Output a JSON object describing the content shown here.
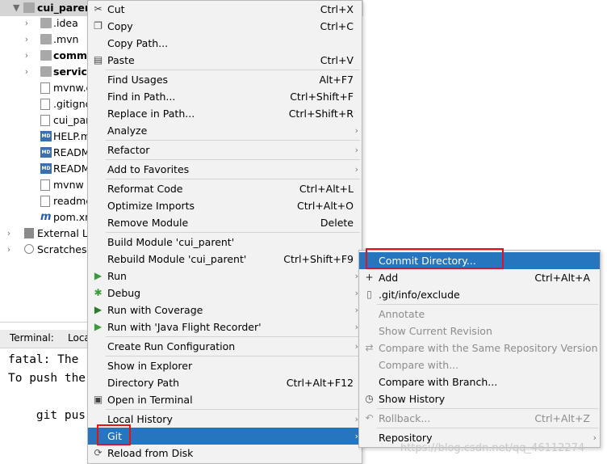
{
  "tree": {
    "root": "cui_parent",
    "items": [
      {
        "label": ".idea",
        "bold": false,
        "icon": "folder"
      },
      {
        "label": ".mvn",
        "bold": false,
        "icon": "folder"
      },
      {
        "label": "commo",
        "bold": true,
        "icon": "folder"
      },
      {
        "label": "service",
        "bold": true,
        "icon": "folder"
      },
      {
        "label": "mvnw.c",
        "bold": false,
        "icon": "file"
      },
      {
        "label": ".gitignc",
        "bold": false,
        "icon": "file"
      },
      {
        "label": "cui_par",
        "bold": false,
        "icon": "file"
      },
      {
        "label": "HELP.m",
        "bold": false,
        "icon": "md"
      },
      {
        "label": "READM",
        "bold": false,
        "icon": "md"
      },
      {
        "label": "READM",
        "bold": false,
        "icon": "md"
      },
      {
        "label": "mvnw",
        "bold": false,
        "icon": "file"
      },
      {
        "label": "readme",
        "bold": false,
        "icon": "file"
      },
      {
        "label": "pom.xn",
        "bold": false,
        "icon": "m"
      }
    ],
    "external": "External Lib",
    "scratches": "Scratches a"
  },
  "terminal": {
    "tab_label": "Terminal:",
    "tab_local": "Loca",
    "lines": [
      "fatal: The",
      "To push the",
      "",
      "    git pus"
    ]
  },
  "menu": {
    "items": [
      {
        "label": "Cut",
        "shortcut": "Ctrl+X",
        "icon": "cut-icon"
      },
      {
        "label": "Copy",
        "shortcut": "Ctrl+C",
        "icon": "copy-icon"
      },
      {
        "label": "Copy Path...",
        "shortcut": ""
      },
      {
        "label": "Paste",
        "shortcut": "Ctrl+V",
        "icon": "paste-icon"
      },
      {
        "label": "Find Usages",
        "shortcut": "Alt+F7"
      },
      {
        "label": "Find in Path...",
        "shortcut": "Ctrl+Shift+F"
      },
      {
        "label": "Replace in Path...",
        "shortcut": "Ctrl+Shift+R"
      },
      {
        "label": "Analyze",
        "shortcut": "",
        "submenu": true
      },
      {
        "label": "Refactor",
        "shortcut": "",
        "submenu": true
      },
      {
        "label": "Add to Favorites",
        "shortcut": "",
        "submenu": true
      },
      {
        "label": "Reformat Code",
        "shortcut": "Ctrl+Alt+L"
      },
      {
        "label": "Optimize Imports",
        "shortcut": "Ctrl+Alt+O"
      },
      {
        "label": "Remove Module",
        "shortcut": "Delete"
      },
      {
        "label": "Build Module 'cui_parent'",
        "shortcut": ""
      },
      {
        "label": "Rebuild Module 'cui_parent'",
        "shortcut": "Ctrl+Shift+F9"
      },
      {
        "label": "Run",
        "shortcut": "",
        "submenu": true,
        "icon": "run-icon"
      },
      {
        "label": "Debug",
        "shortcut": "",
        "submenu": true,
        "icon": "debug-icon"
      },
      {
        "label": "Run with Coverage",
        "shortcut": "",
        "submenu": true,
        "icon": "coverage-icon"
      },
      {
        "label": "Run with 'Java Flight Recorder'",
        "shortcut": "",
        "submenu": true,
        "icon": "flight-recorder-icon"
      },
      {
        "label": "Create Run Configuration",
        "shortcut": "",
        "submenu": true
      },
      {
        "label": "Show in Explorer",
        "shortcut": ""
      },
      {
        "label": "Directory Path",
        "shortcut": "Ctrl+Alt+F12"
      },
      {
        "label": "Open in Terminal",
        "shortcut": "",
        "icon": "terminal-icon"
      },
      {
        "label": "Local History",
        "shortcut": "",
        "submenu": true
      },
      {
        "label": "Git",
        "shortcut": "",
        "submenu": true,
        "highlighted": true
      },
      {
        "label": "Reload from Disk",
        "shortcut": "",
        "icon": "reload-icon"
      }
    ]
  },
  "git_menu": {
    "items": [
      {
        "label": "Commit Directory...",
        "shortcut": "",
        "highlighted": true
      },
      {
        "label": "Add",
        "shortcut": "Ctrl+Alt+A",
        "icon": "add-icon"
      },
      {
        "label": ".git/info/exclude",
        "shortcut": "",
        "icon": "file-icon"
      },
      {
        "label": "Annotate",
        "shortcut": "",
        "disabled": true
      },
      {
        "label": "Show Current Revision",
        "shortcut": "",
        "disabled": true
      },
      {
        "label": "Compare with the Same Repository Version",
        "shortcut": "",
        "disabled": true,
        "icon": "compare-icon"
      },
      {
        "label": "Compare with...",
        "shortcut": "",
        "disabled": true
      },
      {
        "label": "Compare with Branch...",
        "shortcut": ""
      },
      {
        "label": "Show History",
        "shortcut": "",
        "icon": "history-icon"
      },
      {
        "label": "Rollback...",
        "shortcut": "Ctrl+Alt+Z",
        "disabled": true,
        "icon": "rollback-icon"
      },
      {
        "label": "Repository",
        "shortcut": "",
        "submenu": true
      }
    ]
  },
  "watermark": "https://blog.csdn.net/qq_46112274",
  "colors": {
    "highlight": "#2675bf",
    "annotation_box": "#e0141a",
    "menu_bg": "#f2f2f2"
  }
}
